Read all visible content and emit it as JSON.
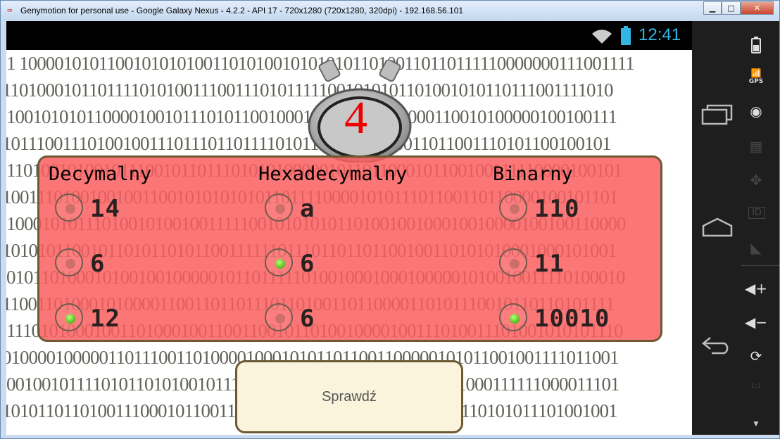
{
  "window": {
    "title": "Genymotion for personal use - Google Galaxy Nexus - 4.2.2 - API 17 - 720x1280 (720x1280, 320dpi) - 192.168.56.101",
    "buttons": {
      "minimize": "▁",
      "maximize": "□",
      "close": "✕"
    }
  },
  "statusbar": {
    "time": "12:41",
    "accent": "#33b5e5"
  },
  "quiz": {
    "timer_value": "4",
    "columns": [
      {
        "label": "Decymalny",
        "options": [
          {
            "value": "14",
            "selected": false
          },
          {
            "value": "6",
            "selected": false
          },
          {
            "value": "12",
            "selected": true
          }
        ]
      },
      {
        "label": "Hexadecymalny",
        "options": [
          {
            "value": "a",
            "selected": false
          },
          {
            "value": "6",
            "selected": true
          },
          {
            "value": "6",
            "selected": false
          }
        ]
      },
      {
        "label": "Binarny",
        "options": [
          {
            "value": "110",
            "selected": false
          },
          {
            "value": "11",
            "selected": false
          },
          {
            "value": "10010",
            "selected": true
          }
        ]
      }
    ],
    "check_button": "Sprawdź"
  },
  "sidebar": {
    "icons": [
      "battery-icon",
      "gps-icon",
      "recent-apps-icon",
      "camera-icon",
      "movie-icon",
      "dpad-icon",
      "home-icon",
      "id-icon",
      "rss-icon",
      "volume-up-icon",
      "volume-down-icon",
      "back-icon",
      "rotate-icon",
      "scale-icon"
    ],
    "gps_label": "GPS",
    "id_label": "ID",
    "scale_label": "1:1"
  },
  "background_digits": [
    "1 10000101011001010101001101010010101010110100110110111110000000111001111",
    "11010001011011110101001110011101011111001010101101001010110111001111010",
    "1001010101100001001011101011001000100101100101000110010100000100100111",
    "10111001110100100111011101101111010110011111100011011001110101100100101",
    "11010010100101110010110111010101000001011011000101100100111110000100101",
    "10011101001001001100101010101011011110000101011101100110110000100101101",
    "10001010111010010100100111110010101010110100100100010010000100100110000",
    "10101011001011010110101100111111011101101101100100110101010001000101001",
    "01011010001010010010000010110111110100100010001000001010010011110100010",
    "11001101000101000011001101101110110100110110000110101110010110110101111",
    "11101010001001101000100110011001011010010000100111010011101001010101110",
    "01000010000011011100110100001000101011011001100000101011001001111011001",
    "00100101111010110101001011101010110110101011100000101000111111000011101",
    "10101101101001110001011001110101011010011100110101000110101011101001001"
  ]
}
